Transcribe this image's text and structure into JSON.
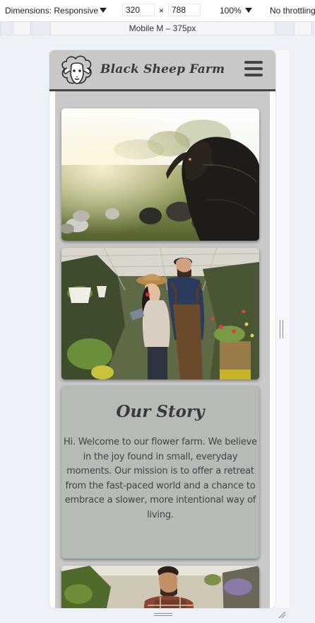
{
  "toolbar": {
    "dimensions_label": "Dimensions: Responsive",
    "width_value": "320",
    "times_sign": "×",
    "height_value": "788",
    "zoom_label": "100%",
    "throttling_label": "No throttling"
  },
  "media_query": {
    "device_label": "Mobile M – 375px"
  },
  "site": {
    "brand_name": "Black Sheep Farm",
    "story_title": "Our Story",
    "story_text": "Hi. Welcome to our flower farm. We believe in the joy found in small, everyday moments. Our mission is to offer a retreat from the fast-paced world and a chance to embrace a slower, more intentional way of living."
  },
  "colors": {
    "header_bg": "#c8c8c8",
    "header_border": "#444444",
    "page_bg": "#c9c9c9",
    "story_card_bg": "#b5bbb5",
    "devtools_bg": "#eef1f8"
  },
  "icons": {
    "logo": "sheep-face-icon",
    "menu": "hamburger-menu-icon",
    "resize": "resize-grip-icon"
  }
}
